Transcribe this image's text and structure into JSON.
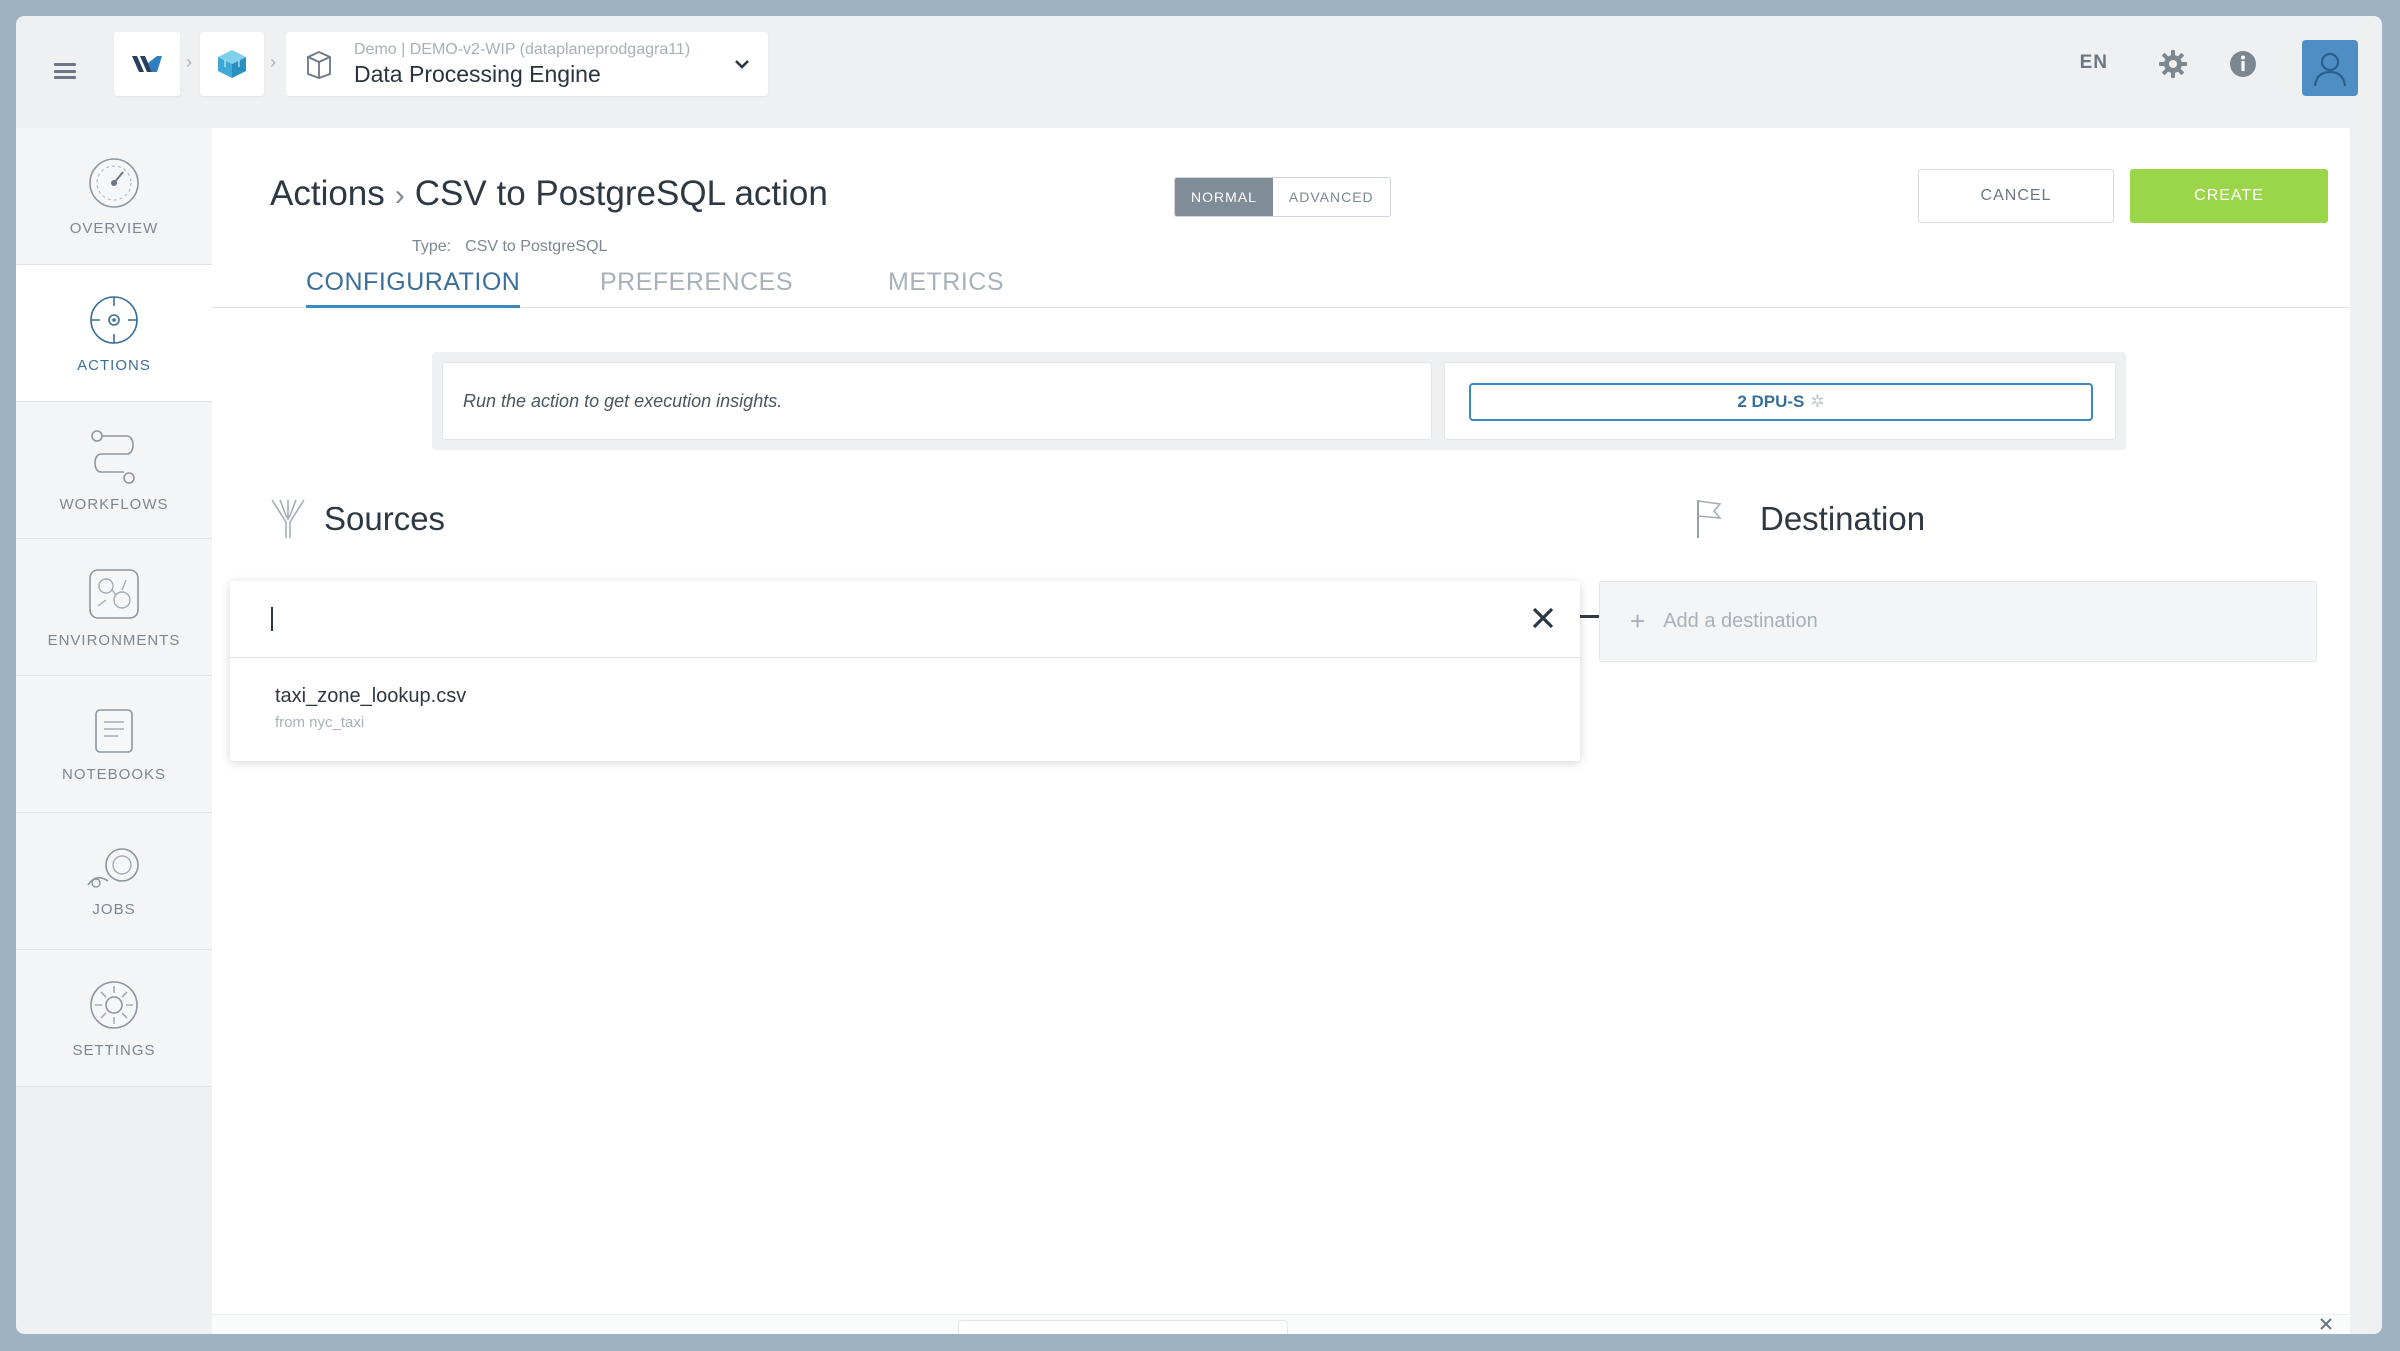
{
  "header": {
    "breadcrumb_sub": "Demo | DEMO-v2-WIP (dataplaneprodgagra11)",
    "engine_title": "Data Processing Engine",
    "language": "EN"
  },
  "sidebar": {
    "items": [
      {
        "label": "OVERVIEW"
      },
      {
        "label": "ACTIONS"
      },
      {
        "label": "WORKFLOWS"
      },
      {
        "label": "ENVIRONMENTS"
      },
      {
        "label": "NOTEBOOKS"
      },
      {
        "label": "JOBS"
      },
      {
        "label": "SETTINGS"
      }
    ]
  },
  "page": {
    "title_parent": "Actions",
    "title_current": "CSV to PostgreSQL action",
    "type_label": "Type:",
    "type_value": "CSV to PostgreSQL",
    "mode_normal": "NORMAL",
    "mode_advanced": "ADVANCED",
    "cancel_label": "CANCEL",
    "create_label": "CREATE"
  },
  "tabs": [
    {
      "label": "CONFIGURATION"
    },
    {
      "label": "PREFERENCES"
    },
    {
      "label": "METRICS"
    }
  ],
  "insights": {
    "message": "Run the action to get execution insights.",
    "dpu_label": "2 DPU-S"
  },
  "sources": {
    "title": "Sources",
    "search_value": "",
    "results": [
      {
        "name": "taxi_zone_lookup.csv",
        "sub": "from nyc_taxi"
      }
    ]
  },
  "destination": {
    "title": "Destination",
    "add_label": "Add a destination"
  },
  "colors": {
    "accent": "#3a87c2",
    "create": "#9bd54a",
    "frame": "#9fb2c4"
  }
}
